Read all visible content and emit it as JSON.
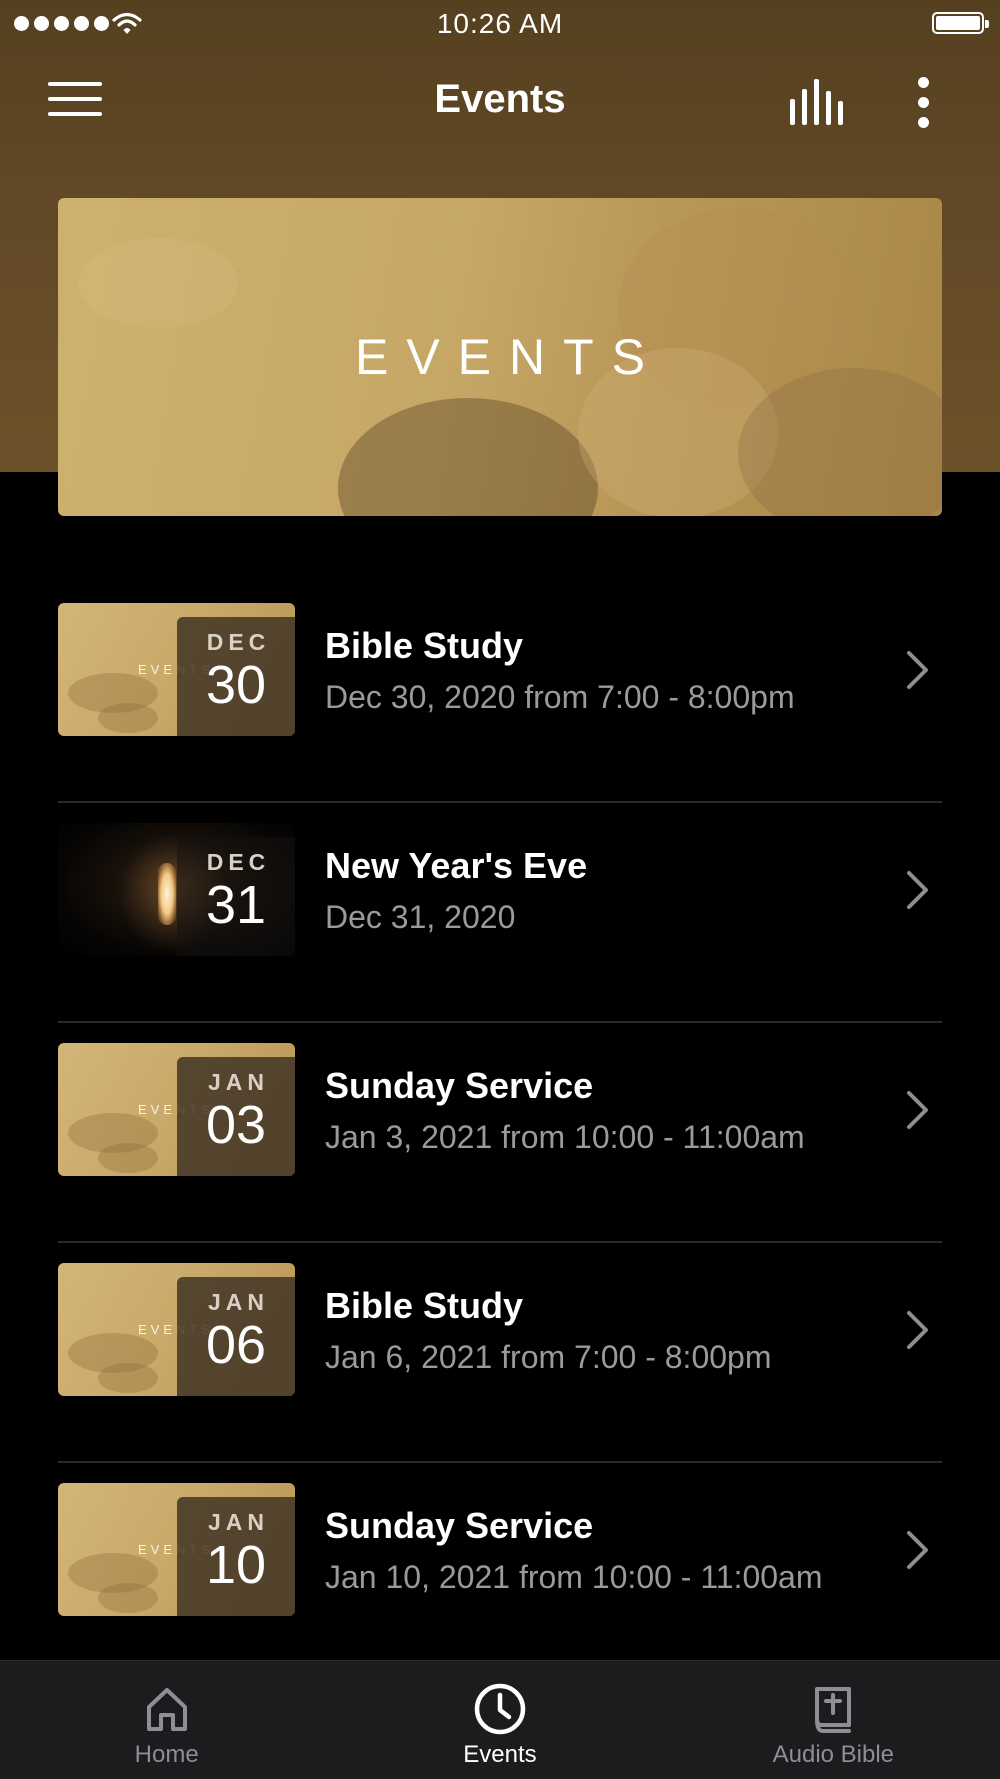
{
  "status_bar": {
    "time": "10:26 AM"
  },
  "nav": {
    "title": "Events"
  },
  "banner": {
    "label": "EVENTS"
  },
  "events": [
    {
      "month": "DEC",
      "day": "30",
      "title": "Bible Study",
      "time": "Dec 30, 2020 from 7:00 - 8:00pm",
      "thumb_label": "EVENTS",
      "thumb": "gold"
    },
    {
      "month": "DEC",
      "day": "31",
      "title": "New Year's Eve",
      "time": "Dec 31, 2020",
      "thumb_label": "",
      "thumb": "dark"
    },
    {
      "month": "JAN",
      "day": "03",
      "title": "Sunday Service",
      "time": "Jan 3, 2021 from 10:00 - 11:00am",
      "thumb_label": "EVENTS",
      "thumb": "gold"
    },
    {
      "month": "JAN",
      "day": "06",
      "title": "Bible Study",
      "time": "Jan 6, 2021 from 7:00 - 8:00pm",
      "thumb_label": "EVENTS",
      "thumb": "gold"
    },
    {
      "month": "JAN",
      "day": "10",
      "title": "Sunday Service",
      "time": "Jan 10, 2021 from 10:00 - 11:00am",
      "thumb_label": "EVENTS",
      "thumb": "gold"
    }
  ],
  "tabs": [
    {
      "label": "Home",
      "icon": "home-icon",
      "active": false
    },
    {
      "label": "Events",
      "icon": "clock-icon",
      "active": true
    },
    {
      "label": "Audio Bible",
      "icon": "bible-icon",
      "active": false
    }
  ],
  "colors": {
    "header_bg": "#5a4322",
    "background": "#000000",
    "tab_bar_bg": "#1c1c1e",
    "secondary_text": "#9a9a9a"
  }
}
